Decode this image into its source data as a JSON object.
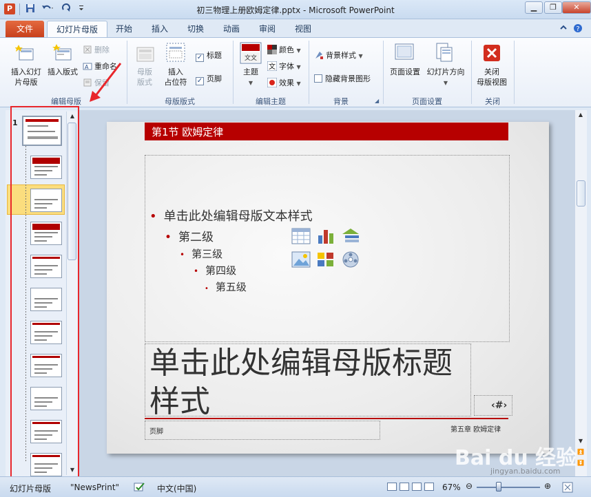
{
  "window": {
    "title": "初三物理上册欧姆定律.pptx - Microsoft PowerPoint",
    "app_icon": "P",
    "controls": [
      "minimize-icon",
      "restore-icon",
      "close-icon"
    ]
  },
  "qat": {
    "items": [
      "save-icon",
      "undo-icon",
      "redo-icon",
      "customize-icon"
    ]
  },
  "tabs": [
    {
      "label": "文件"
    },
    {
      "label": "幻灯片母版"
    },
    {
      "label": "开始"
    },
    {
      "label": "插入"
    },
    {
      "label": "切换"
    },
    {
      "label": "动画"
    },
    {
      "label": "审阅"
    },
    {
      "label": "视图"
    }
  ],
  "ribbon": {
    "edit_master": {
      "label": "编辑母版",
      "insert_slide_master": "插入幻灯\n片母版",
      "insert_layout": "插入版式",
      "delete": "删除",
      "rename": "重命名",
      "preserve": "保留"
    },
    "master_layout": {
      "label": "母版版式",
      "master_layout_btn": "母版\n版式",
      "insert_placeholder": "插入\n占位符",
      "title_check": "标题",
      "footer_check": "页脚"
    },
    "edit_theme": {
      "label": "编辑主题",
      "themes": "主题",
      "colors": "颜色",
      "fonts": "字体",
      "effects": "效果",
      "theme_preview_text": "文文"
    },
    "background": {
      "label": "背景",
      "background_styles": "背景样式",
      "hide_bg_graphics": "隐藏背景图形"
    },
    "page_setup": {
      "label": "页面设置",
      "page_setup_btn": "页面设置",
      "slide_orientation": "幻灯片方向"
    },
    "close": {
      "label": "关闭",
      "close_master_view": "关闭\n母版视图"
    }
  },
  "thumbnails": {
    "master_number": "1",
    "count": 11,
    "selected_index": 2
  },
  "slide": {
    "banner": "第1节    欧姆定律",
    "bullets": [
      {
        "level": 1,
        "text": "单击此处编辑母版文本样式"
      },
      {
        "level": 2,
        "text": "第二级"
      },
      {
        "level": 3,
        "text": "第三级"
      },
      {
        "level": 4,
        "text": "第四级"
      },
      {
        "level": 5,
        "text": "第五级"
      }
    ],
    "title_placeholder": "单击此处编辑母版标题样式",
    "slide_number": "‹#›",
    "footer": "页脚",
    "footer_right": "第五章  欧姆定律",
    "content_icons": [
      "table-icon",
      "chart-icon",
      "smartart-icon",
      "picture-icon",
      "clipart-icon",
      "media-icon"
    ]
  },
  "status": {
    "view": "幻灯片母版",
    "theme": "\"NewsPrint\"",
    "language": "中文(中国)",
    "zoom": "67%",
    "zoom_fraction": 0.35
  },
  "watermark": {
    "logo": "Bai du 经验",
    "url": "jingyan.baidu.com"
  },
  "colors": {
    "accent": "#b70000",
    "file_tab": "#c8401c",
    "annotation": "#e8262b"
  }
}
